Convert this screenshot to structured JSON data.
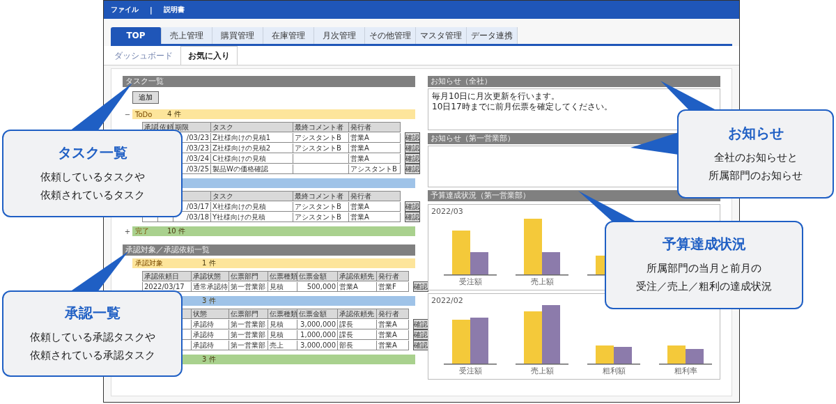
{
  "menu_bar": {
    "items": [
      "ファイル",
      "|",
      "説明書"
    ]
  },
  "tabs": [
    {
      "label": "TOP",
      "selected": true
    },
    {
      "label": "売上管理",
      "selected": false
    },
    {
      "label": "購買管理",
      "selected": false
    },
    {
      "label": "在庫管理",
      "selected": false
    },
    {
      "label": "月次管理",
      "selected": false
    },
    {
      "label": "その他管理",
      "selected": false
    },
    {
      "label": "マスタ管理",
      "selected": false
    },
    {
      "label": "データ連携",
      "selected": false
    }
  ],
  "sub_tabs": [
    {
      "label": "ダッシュボード",
      "selected": false
    },
    {
      "label": "お気に入り",
      "selected": true
    }
  ],
  "task_list": {
    "title": "タスク一覧",
    "add_button": "追加",
    "groups": [
      {
        "toggle": "−",
        "label": "ToDo",
        "count": "4 件",
        "color": "#fde59b",
        "columns": [
          "承認",
          "依頼",
          "期限",
          "タスク",
          "最終コメント者",
          "発行者"
        ],
        "rows": [
          {
            "cells": [
              "",
              "",
              "/03/23",
              "Z社様向けの見積1",
              "アシスタントB",
              "営業A"
            ],
            "button": "確認"
          },
          {
            "cells": [
              "",
              "",
              "/03/23",
              "Z社様向けの見積2",
              "アシスタントB",
              "営業A"
            ],
            "button": "確認"
          },
          {
            "cells": [
              "",
              "",
              "/03/24",
              "C社様向けの見積",
              "",
              "営業A"
            ],
            "button": "確認"
          },
          {
            "cells": [
              "",
              "",
              "/03/25",
              "製品Wの価格確認",
              "",
              "アシスタントB"
            ],
            "button": "確認"
          }
        ]
      },
      {
        "color": "#9fc3e8",
        "columns": [
          "",
          "",
          "",
          "タスク",
          "最終コメント者",
          "発行者"
        ],
        "rows": [
          {
            "cells": [
              "",
              "",
              "/03/17",
              "X社様向けの見積",
              "アシスタントB",
              "営業A"
            ],
            "button": "確認"
          },
          {
            "cells": [
              "",
              "",
              "/03/18",
              "Y社様向けの見積",
              "アシスタントB",
              "営業A"
            ],
            "button": "確認"
          }
        ]
      },
      {
        "toggle": "+",
        "label": "完了",
        "count": "10 件",
        "color": "#a9d18e"
      }
    ]
  },
  "approval_list": {
    "title": "承認対象／承認依頼一覧",
    "groups": [
      {
        "label": "承認対象",
        "count": "1 件",
        "color": "#fde59b",
        "columns": [
          "承認依頼日",
          "承認状態",
          "伝票部門",
          "伝票種類",
          "伝票金額",
          "承認依頼先",
          "発行者"
        ],
        "rows": [
          {
            "cells": [
              "2022/03/17",
              "通常承認待",
              "第一営業部",
              "見積",
              "500,000",
              "営業A",
              "営業F"
            ],
            "button": "確認"
          }
        ]
      },
      {
        "count": "3 件",
        "color": "#9fc3e8",
        "columns": [
          "",
          "状態",
          "伝票部門",
          "伝票種類",
          "伝票金額",
          "承認依頼先",
          "発行者"
        ],
        "rows": [
          {
            "cells": [
              "",
              "承認待",
              "第一営業部",
              "見積",
              "3,000,000",
              "課長",
              "営業A"
            ],
            "button": "確認"
          },
          {
            "cells": [
              "",
              "承認待",
              "第一営業部",
              "見積",
              "1,000,000",
              "課長",
              "営業A"
            ],
            "button": "確認"
          },
          {
            "cells": [
              "",
              "承認待",
              "第一営業部",
              "売上",
              "3,000,000",
              "部長",
              "営業A"
            ],
            "button": "確認"
          }
        ]
      },
      {
        "count": "3 件",
        "color": "#a9d18e"
      }
    ]
  },
  "notices": [
    {
      "title": "お知らせ（全社）",
      "lines": [
        "毎月10日に月次更新を行います。",
        "10日17時までに前月伝票を確定してください。"
      ]
    },
    {
      "title": "お知らせ（第一営業部）"
    }
  ],
  "budget": {
    "title": "予算達成状況（第一営業部）",
    "charts": [
      {
        "period": "2022/03",
        "category_labels": [
          "受注額",
          "売上額"
        ]
      },
      {
        "period": "2022/02",
        "category_labels": [
          "受注額",
          "売上額",
          "粗利額",
          "粗利率"
        ]
      }
    ]
  },
  "callouts": [
    {
      "title": "タスク一覧",
      "lines": [
        "依頼しているタスクや",
        "依頼されているタスク"
      ]
    },
    {
      "title": "承認一覧",
      "lines": [
        "依頼している承認タスクや",
        "依頼されている承認タスク"
      ]
    },
    {
      "title": "お知らせ",
      "lines": [
        "全社のお知らせと",
        "所属部門のお知らせ"
      ]
    },
    {
      "title": "予算達成状況",
      "lines": [
        "所属部門の当月と前月の",
        "受注／売上／粗利の達成状況"
      ]
    }
  ]
}
